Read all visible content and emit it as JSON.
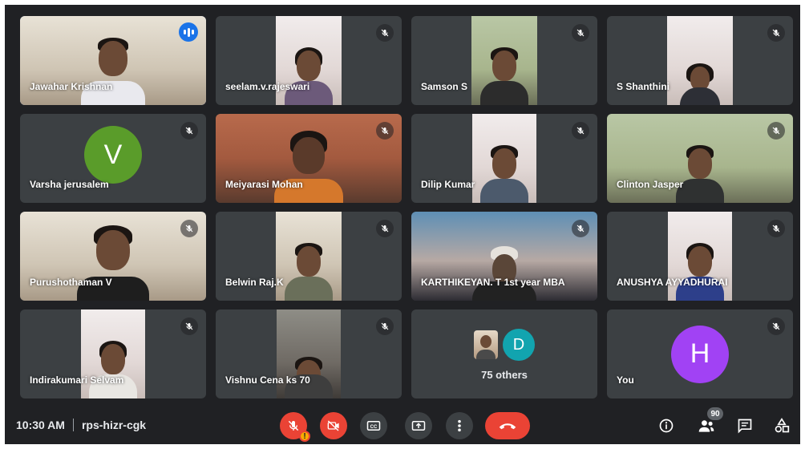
{
  "participants": [
    {
      "name": "Jawahar Krishnan",
      "speaking": true
    },
    {
      "name": "seelam.v.rajeswari",
      "muted": true
    },
    {
      "name": "Samson S",
      "muted": true
    },
    {
      "name": "S Shanthini",
      "muted": true
    },
    {
      "name": "Varsha jerusalem",
      "muted": true,
      "avatar_letter": "V",
      "avatar_color": "#5a9c2a"
    },
    {
      "name": "Meiyarasi Mohan",
      "muted": true
    },
    {
      "name": "Dilip Kumar",
      "muted": true
    },
    {
      "name": "Clinton Jasper",
      "muted": true
    },
    {
      "name": "Purushothaman V",
      "muted": true
    },
    {
      "name": "Belwin Raj.K",
      "muted": true
    },
    {
      "name": "KARTHIKEYAN. T 1st year MBA",
      "muted": true
    },
    {
      "name": "ANUSHYA AYYADHURAI",
      "muted": true
    },
    {
      "name": "Indirakumari Selvam",
      "muted": true
    },
    {
      "name": "Vishnu Cena ks 70",
      "muted": true
    }
  ],
  "others_tile": {
    "label": "75 others",
    "avatar_letter": "D",
    "avatar_color": "#12a4af"
  },
  "self_tile": {
    "name": "You",
    "avatar_letter": "H",
    "avatar_color": "#a142f4",
    "muted": true
  },
  "meeting": {
    "time": "10:30 AM",
    "code": "rps-hizr-cgk"
  },
  "toolbar": {
    "mic_icon": "mic-off-icon",
    "mic_warning": "!",
    "camera_icon": "camera-off-icon",
    "captions_icon": "captions-icon",
    "present_icon": "present-screen-icon",
    "more_icon": "more-options-icon",
    "end_call_icon": "end-call-icon",
    "info_icon": "info-icon",
    "people_icon": "people-icon",
    "people_count": "90",
    "chat_icon": "chat-icon",
    "activities_icon": "activities-icon"
  },
  "colors": {
    "background": "#202124",
    "tile": "#3c4043",
    "accent": "#1a73e8",
    "danger": "#ea4335"
  }
}
